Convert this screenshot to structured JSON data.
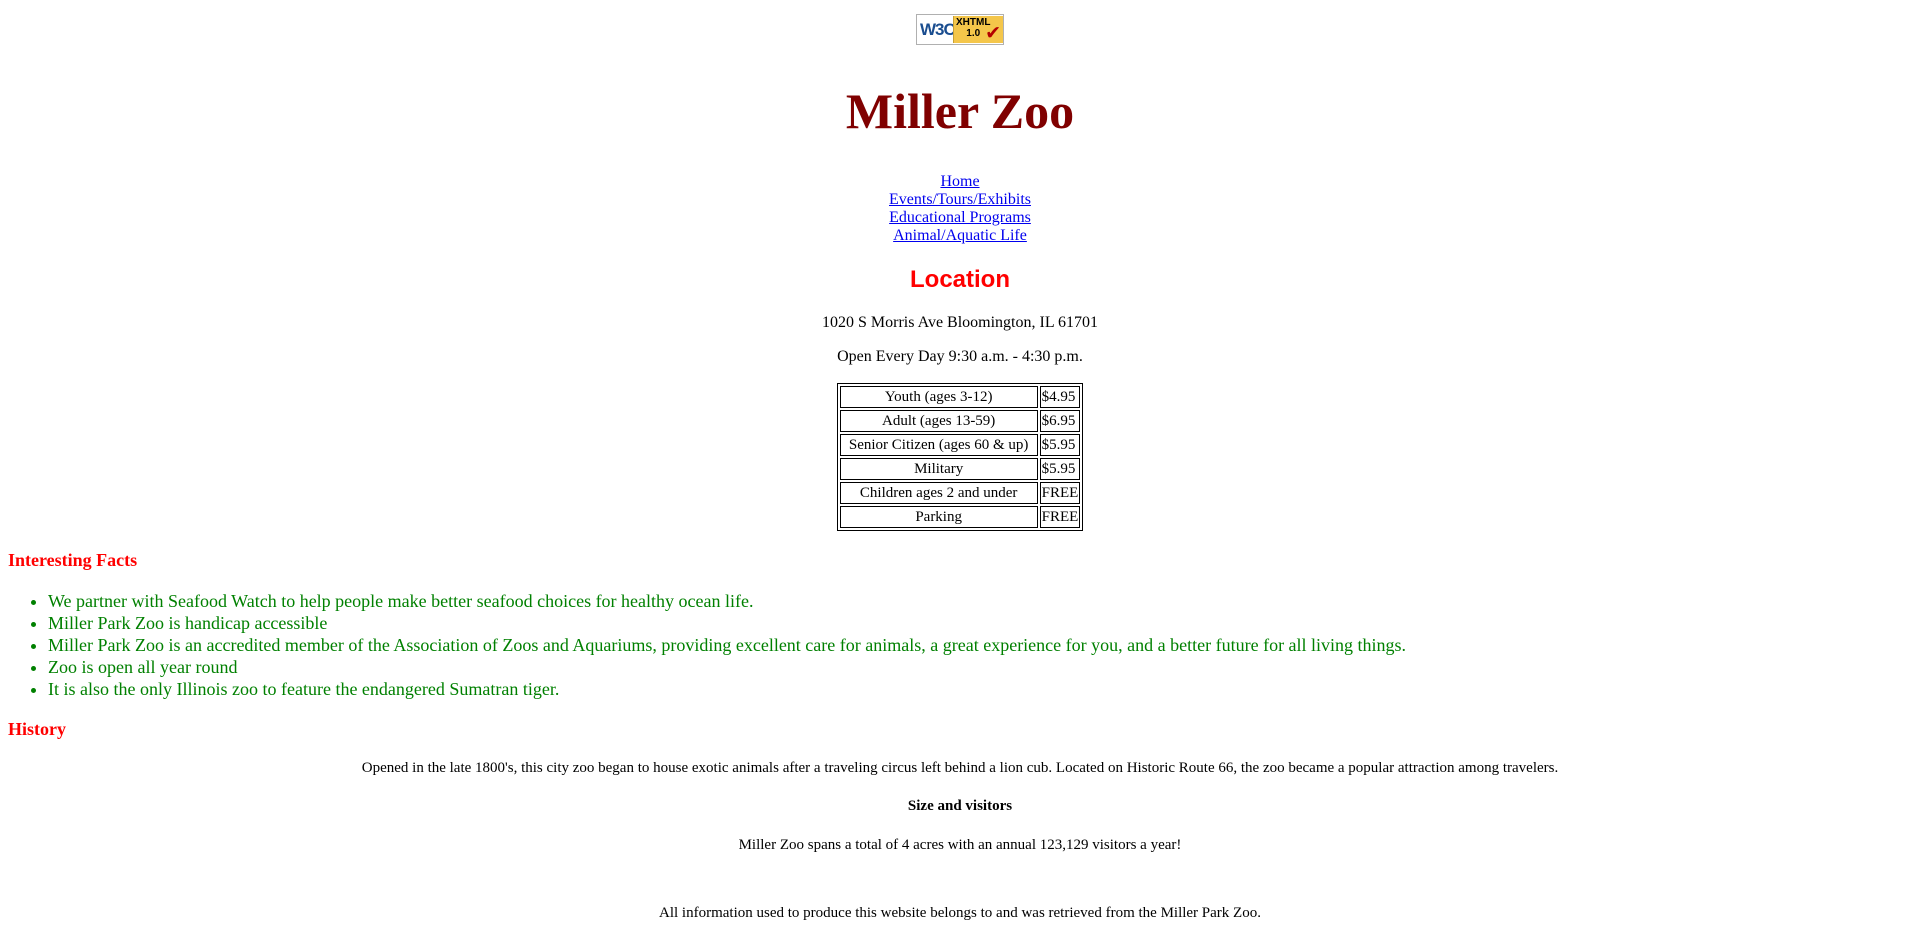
{
  "badge": {
    "w3c_text": "W3C",
    "xhtml_text": "XHTML",
    "version_text": "1.0",
    "icon": "checkmark-icon"
  },
  "site": {
    "title": "Miller Zoo",
    "title_color": "#800000"
  },
  "nav": {
    "items": [
      {
        "label": "Home"
      },
      {
        "label": "Events/Tours/Exhibits"
      },
      {
        "label": "Educational Programs"
      },
      {
        "label": "Animal/Aquatic Life"
      }
    ],
    "link_color": "#0000ee"
  },
  "location": {
    "heading": "Location",
    "address": "1020 S Morris Ave Bloomington, IL 61701",
    "hours": "Open Every Day 9:30 a.m. - 4:30 p.m.",
    "heading_color": "#ff0000"
  },
  "prices": [
    {
      "category": "Youth (ages 3-12)",
      "price": "$4.95"
    },
    {
      "category": "Adult (ages 13-59)",
      "price": "$6.95"
    },
    {
      "category": "Senior Citizen (ages 60 & up)",
      "price": "$5.95"
    },
    {
      "category": "Military",
      "price": "$5.95"
    },
    {
      "category": "Children ages 2 and under",
      "price": "FREE"
    },
    {
      "category": "Parking",
      "price": "FREE"
    }
  ],
  "facts": {
    "heading": "Interesting Facts",
    "text_color": "#008000",
    "items": [
      "We partner with Seafood Watch to help people make better seafood choices for healthy ocean life.",
      "Miller Park Zoo is handicap accessible",
      "Miller Park Zoo is an accredited member of the Association of Zoos and Aquariums, providing excellent care for animals, a great experience for you, and a better future for all living things.",
      "Zoo is open all year round",
      "It is also the only Illinois zoo to feature the endangered Sumatran tiger."
    ]
  },
  "history": {
    "heading": "History",
    "text": "Opened in the late 1800's, this city zoo began to house exotic animals after a traveling circus left behind a lion cub. Located on Historic Route 66, the zoo became a popular attraction among travelers.",
    "size_heading": "Size and visitors",
    "size_text": "Miller Zoo spans a total of 4 acres with an annual 123,129 visitors a year!"
  },
  "footer": {
    "text": "All information used to produce this website belongs to and was retrieved from the Miller Park Zoo."
  }
}
